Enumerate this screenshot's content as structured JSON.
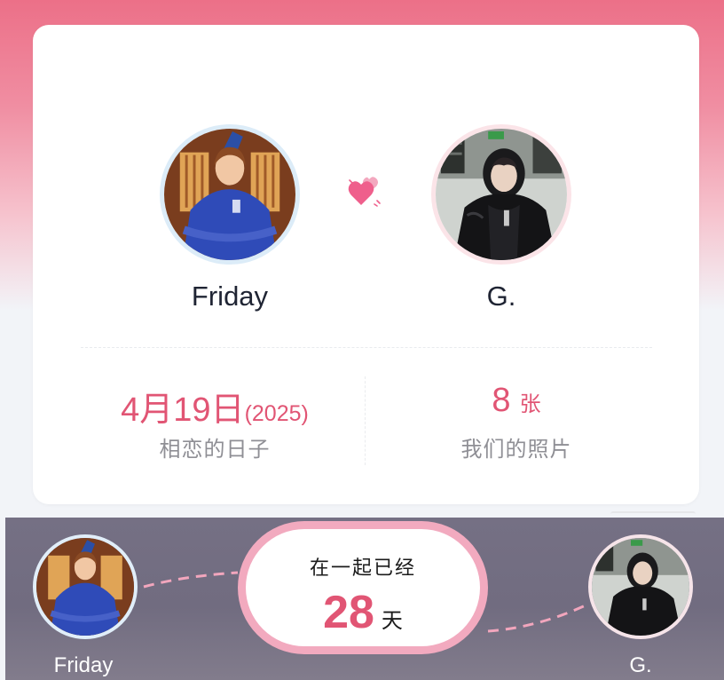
{
  "couple": {
    "left_name": "Friday",
    "right_name": "G."
  },
  "stats": {
    "anniversary_date": "4月19日",
    "anniversary_year": "(2025)",
    "anniversary_label": "相恋的日子",
    "photo_count": "8",
    "photo_unit": "张",
    "photo_label": "我们的照片"
  },
  "banner": {
    "title": "在一起已经",
    "days": "28",
    "days_unit": "天",
    "left_name": "Friday",
    "right_name": "G."
  },
  "icons": {
    "center_heart": "heart-icon"
  },
  "colors": {
    "accent": "#e15574",
    "header_pink": "#ec7088",
    "pill_border": "#f2aabf"
  }
}
